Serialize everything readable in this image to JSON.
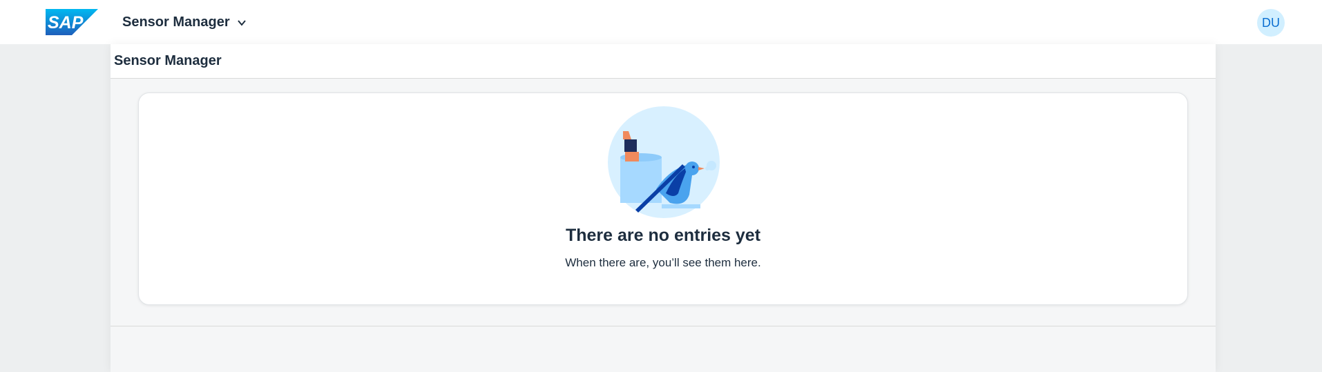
{
  "shellbar": {
    "logo_text": "SAP",
    "app_title": "Sensor Manager",
    "avatar_initials": "DU",
    "colors": {
      "logo_blue": "#0a6ed1",
      "avatar_bg": "#d1efff",
      "avatar_text": "#0a6ed1"
    }
  },
  "page": {
    "title": "Sensor Manager"
  },
  "empty_state": {
    "title": "There are no entries yet",
    "subtitle": "When there are, you’ll see them here.",
    "illustration": "bird-with-cup-illustration"
  }
}
